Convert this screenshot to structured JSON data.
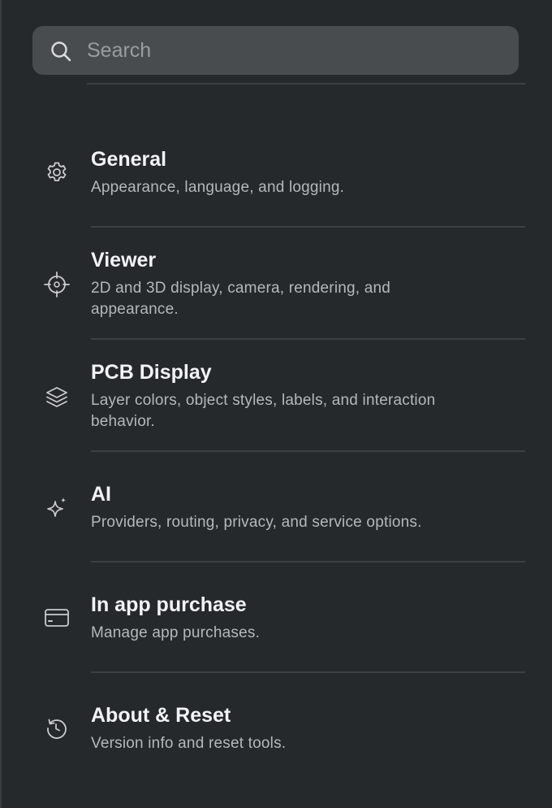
{
  "search": {
    "placeholder": "Search",
    "icon": "search-icon"
  },
  "items": [
    {
      "title": "General",
      "description": "Appearance, language, and logging.",
      "icon": "gear-icon"
    },
    {
      "title": "Viewer",
      "description": "2D and 3D display, camera, rendering, and appearance.",
      "icon": "crosshair-icon"
    },
    {
      "title": "PCB Display",
      "description": "Layer colors, object styles, labels, and interaction behavior.",
      "icon": "layers-icon"
    },
    {
      "title": "AI",
      "description": "Providers, routing, privacy, and service options.",
      "icon": "sparkles-icon"
    },
    {
      "title": "In app purchase",
      "description": "Manage app purchases.",
      "icon": "credit-card-icon"
    },
    {
      "title": "About & Reset",
      "description": "Version info and reset tools.",
      "icon": "reset-icon"
    }
  ],
  "colors": {
    "background": "#25292c",
    "search_background": "#484c4f",
    "title": "#f2f3f4",
    "description": "#b5b8bb",
    "divider": "#3c4043",
    "icon": "#c9cbcd"
  }
}
